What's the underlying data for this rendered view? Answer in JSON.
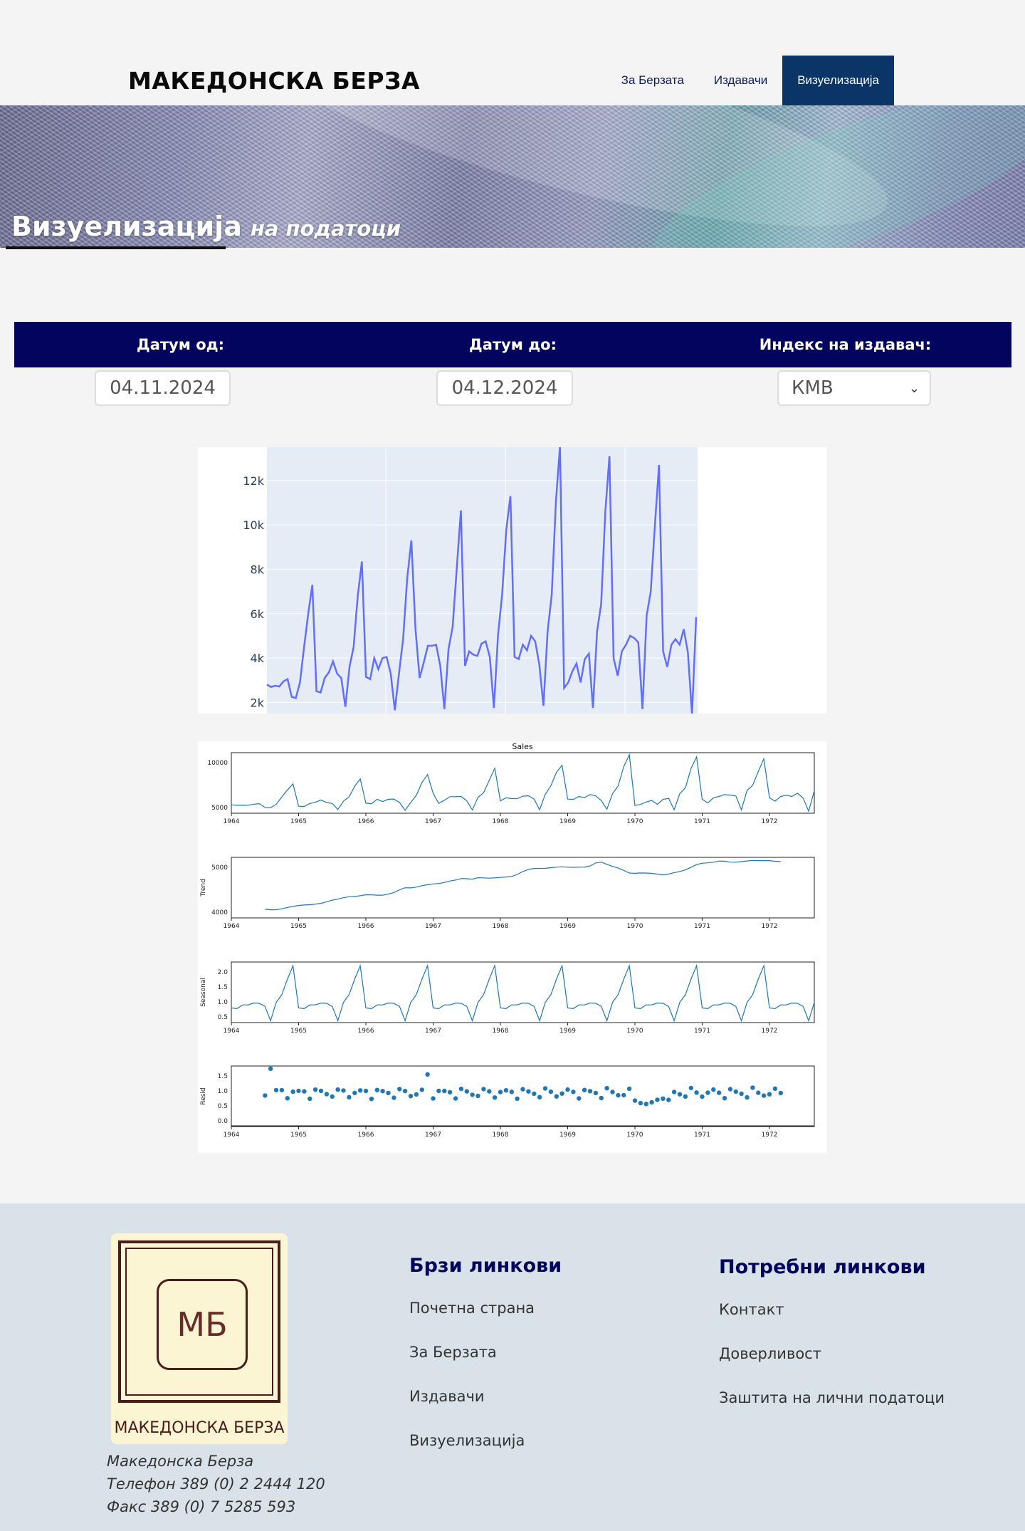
{
  "brand": "МАКЕДОНСКА БЕРЗА",
  "nav": [
    {
      "label": "За Берзата",
      "active": false
    },
    {
      "label": "Издавачи",
      "active": false
    },
    {
      "label": "Визуелизација",
      "active": true
    }
  ],
  "hero": {
    "title": "Визуелизација",
    "subtitle": "на податоци"
  },
  "filters": {
    "date_from_label": "Датум од:",
    "date_to_label": "Датум до:",
    "index_label": "Индекс на издавач:",
    "date_from_value": "04.11.2024",
    "date_to_value": "04.12.2024",
    "index_value": "КМВ"
  },
  "chart_data": [
    {
      "type": "line",
      "title": "",
      "xlabel": "",
      "ylabel": "",
      "ylim": [
        1500,
        13500
      ],
      "yticks": [
        "2k",
        "4k",
        "6k",
        "8k",
        "10k",
        "12k"
      ],
      "series": [
        {
          "values": [
            2800,
            2700,
            2750,
            2720,
            2950,
            3050,
            2250,
            2200,
            2900,
            4500,
            6000,
            7300,
            2500,
            2450,
            3100,
            3350,
            3850,
            3300,
            3100,
            1800,
            3600,
            4500,
            6800,
            8350,
            3150,
            3050,
            4000,
            3500,
            4000,
            4050,
            3300,
            1650,
            3300,
            4850,
            7600,
            9300,
            5300,
            3100,
            3800,
            4550,
            4550,
            4600,
            3650,
            1700,
            4400,
            5400,
            8050,
            10650,
            3650,
            4300,
            4150,
            4100,
            4650,
            4750,
            4050,
            1750,
            5050,
            6900,
            9800,
            11300,
            4050,
            3950,
            4600,
            4350,
            5000,
            4750,
            3700,
            1850,
            5200,
            6850,
            11000,
            13550,
            2650,
            2900,
            3400,
            3750,
            2900,
            3950,
            4200,
            1750,
            5200,
            6450,
            10600,
            13100,
            4000,
            3200,
            4300,
            4600,
            5000,
            4900,
            4700,
            1700,
            5900,
            7000,
            9950,
            12700,
            4300,
            3600,
            4600,
            4850,
            4600,
            5300,
            4250,
            1450,
            5850
          ]
        }
      ]
    },
    {
      "type": "line",
      "title": "Sales",
      "panels": [
        "Sales",
        "Trend",
        "Seasonal",
        "Resid"
      ],
      "x_ticks": [
        "1964",
        "1965",
        "1966",
        "1967",
        "1968",
        "1969",
        "1970",
        "1971",
        "1972"
      ],
      "panel_yticks": [
        [
          "10000",
          "5000"
        ],
        [
          "5000",
          "4000"
        ],
        [
          "2.0",
          "1.5",
          "1.0",
          "0.5"
        ],
        [
          "1.5",
          "1.0",
          "0.5",
          "0.0"
        ]
      ],
      "panel_ylabels": [
        "",
        "Trend",
        "Seasonal",
        "Resid"
      ]
    }
  ],
  "footer": {
    "logo_initials": "МБ",
    "logo_text": "МАКЕДОНСКА БЕРЗА",
    "company_name": "Македонска Берза",
    "phone": "Телефон 389 (0) 2 2444 120",
    "fax": "Факс 389 (0) 7 5285 593",
    "quick_links_title": "Брзи линкови",
    "quick_links": [
      "Почетна страна",
      "За Берзата",
      "Издавачи",
      "Визуелизација"
    ],
    "needed_links_title": "Потребни линкови",
    "needed_links": [
      "Контакт",
      "Доверливост",
      "Заштита на лични податоци"
    ]
  }
}
